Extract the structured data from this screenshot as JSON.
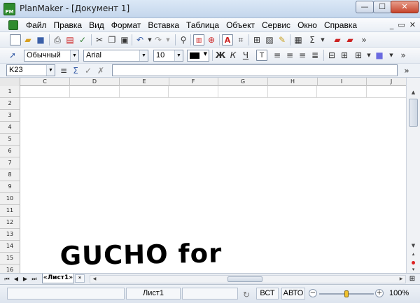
{
  "window": {
    "app_icon_text": "PM",
    "title": "PlanMaker - [Документ 1]",
    "min_glyph": "—",
    "max_glyph": "☐",
    "close_glyph": "✕"
  },
  "menu": {
    "items": [
      "Файл",
      "Правка",
      "Вид",
      "Формат",
      "Вставка",
      "Таблица",
      "Объект",
      "Сервис",
      "Окно",
      "Справка"
    ],
    "mdi_min": "_",
    "mdi_restore": "▭",
    "mdi_close": "✕"
  },
  "format_toolbar": {
    "style": "Обычный",
    "font": "Arial",
    "size": "10"
  },
  "formula_bar": {
    "cell_ref": "K23",
    "value": ""
  },
  "grid": {
    "columns": [
      "C",
      "D",
      "E",
      "F",
      "G",
      "H",
      "I",
      "J"
    ],
    "rows": [
      "1",
      "2",
      "3",
      "4",
      "5",
      "6",
      "7",
      "8",
      "9",
      "10",
      "11",
      "12",
      "13",
      "14",
      "15",
      "16"
    ]
  },
  "sheets": {
    "tabs": [
      "«Лист1»"
    ],
    "add_tab": "*"
  },
  "status": {
    "sheet_name": "Лист1",
    "insert_mode": "ВСТ",
    "calc_mode": "АВТО",
    "zoom": "100%",
    "zoom_level": 0.5
  },
  "watermark": "GUCHO for www.CWER.ru",
  "colors": {
    "text_color": "#000000",
    "accent_green": "#2e8b2e"
  }
}
